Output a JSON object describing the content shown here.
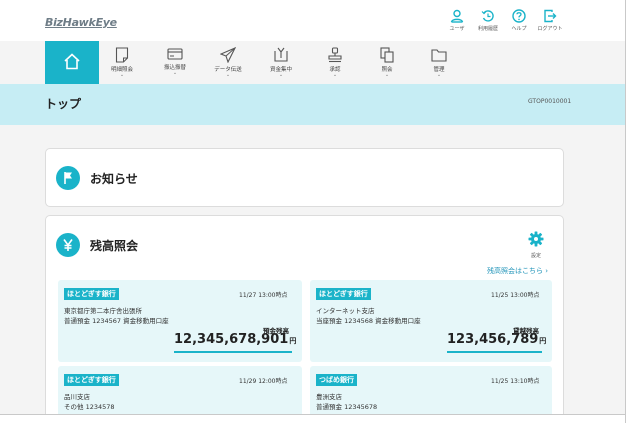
{
  "app": {
    "logo": "BizHawkEye"
  },
  "utility_nav": [
    {
      "label": "ユーザ",
      "icon": "user-icon"
    },
    {
      "label": "利用履歴",
      "icon": "history-icon"
    },
    {
      "label": "ヘルプ",
      "icon": "help-icon"
    },
    {
      "label": "ログアウト",
      "icon": "logout-icon"
    }
  ],
  "main_nav": {
    "home_icon": "home-icon",
    "items": [
      {
        "label": "明細照会",
        "icon": "statement-icon"
      },
      {
        "label": "振込振替",
        "icon": "transfer-icon"
      },
      {
        "label": "データ伝送",
        "icon": "send-icon"
      },
      {
        "label": "資金集中",
        "icon": "fund-concentration-icon"
      },
      {
        "label": "承認",
        "icon": "approval-icon"
      },
      {
        "label": "照会",
        "icon": "inquiry-icon"
      },
      {
        "label": "管理",
        "icon": "folder-icon"
      }
    ]
  },
  "page": {
    "title": "トップ",
    "screen_id": "GTOP0010001"
  },
  "notice": {
    "heading": "お知らせ"
  },
  "balance": {
    "heading": "残高照会",
    "settings_label": "設定",
    "more_link": "残高照会はこちら ›",
    "accounts": [
      {
        "bank": "ほとどぎす銀行",
        "timestamp": "11/27 13:00時点",
        "branch": "東京都庁第二本庁舎出張所",
        "account_line": "普通預金 1234567  資金移動用口座",
        "balance_label": "預金残高",
        "amount": "12,345,678,901",
        "currency": "円"
      },
      {
        "bank": "ほとどぎす銀行",
        "timestamp": "11/25 13:00時点",
        "branch": "インターネット支店",
        "account_line": "当座預金 1234568  資金移動用口座",
        "balance_label": "貸越残高",
        "amount": "123,456,789",
        "currency": "円"
      },
      {
        "bank": "ほとどぎす銀行",
        "timestamp": "11/29 12:00時点",
        "branch": "品川支店",
        "account_line": "その他 1234578"
      },
      {
        "bank": "つばめ銀行",
        "timestamp": "11/25 13:10時点",
        "branch": "豊洲支店",
        "account_line": "普通預金 12345678"
      }
    ]
  },
  "colors": {
    "accent": "#1ab3c9",
    "title_band": "#c6edf4",
    "account_card": "#e6f7f9",
    "link": "#1f93b8"
  }
}
